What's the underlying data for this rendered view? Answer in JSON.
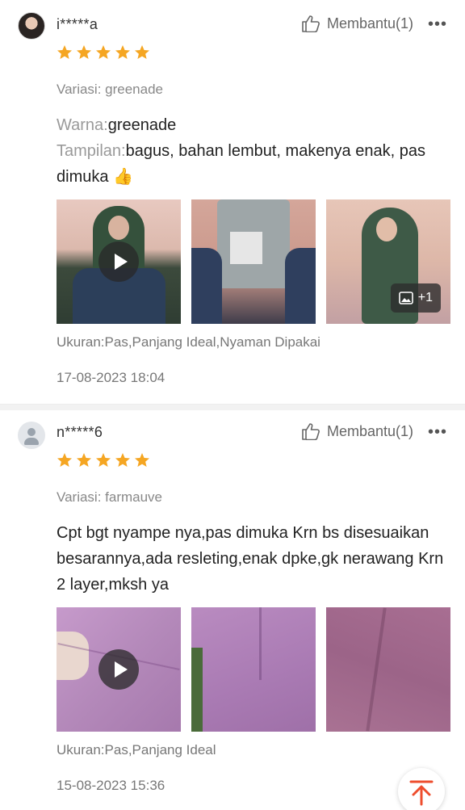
{
  "reviews": [
    {
      "username": "i*****a",
      "helpful_label": "Membantu(1)",
      "rating": 5,
      "variant": "Variasi: greenade",
      "body": {
        "color_label": "Warna:",
        "color_value": "greenade",
        "look_label": "Tampilan:",
        "look_value": "bagus, bahan lembut, makenya enak, pas dimuka 👍"
      },
      "media": [
        {
          "kind": "video"
        },
        {
          "kind": "image"
        },
        {
          "kind": "image",
          "more_count": "+1"
        }
      ],
      "size_info": "Ukuran:Pas,Panjang Ideal,Nyaman Dipakai",
      "date": "17-08-2023 18:04"
    },
    {
      "username": "n*****6",
      "helpful_label": "Membantu(1)",
      "rating": 5,
      "variant": "Variasi: farmauve",
      "text": "Cpt bgt nyampe nya,pas dimuka Krn bs disesuaikan besarannya,ada resleting,enak dpke,gk nerawang Krn 2 layer,mksh ya",
      "media": [
        {
          "kind": "video"
        },
        {
          "kind": "image"
        },
        {
          "kind": "image"
        }
      ],
      "size_info": "Ukuran:Pas,Panjang Ideal",
      "date": "15-08-2023 15:36"
    }
  ],
  "colors": {
    "star": "#f5a623",
    "scroll_top_arrow": "#ee4d2d",
    "muted_text": "#888888"
  },
  "icons": {
    "helpful": "thumbs-up-icon",
    "more": "more-dots-icon",
    "play": "play-icon",
    "gallery": "image-icon",
    "scroll_top": "arrow-up-to-top-icon"
  }
}
